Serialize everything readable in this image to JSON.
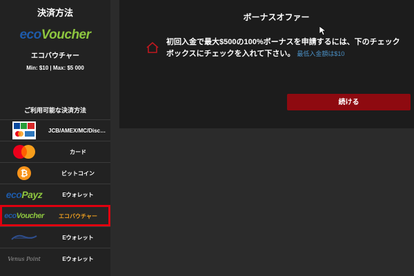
{
  "sidebar": {
    "title": "決済方法",
    "logo_text_a": "eco",
    "logo_text_b": "Voucher",
    "method_name": "エコバウチャー",
    "limits": "Min: $10 | Max: $5 000",
    "available_heading": "ご利用可能な決済方法",
    "methods": [
      {
        "label": "JCB/AMEX/MC/Disco…",
        "icon": "credit-cards-icon"
      },
      {
        "label": "カード",
        "icon": "mastercard-icon"
      },
      {
        "label": "ビットコイン",
        "icon": "bitcoin-icon"
      },
      {
        "label": "Eウォレット",
        "icon": "ecopayz-logo",
        "logo_a": "eco",
        "logo_b": "Payz"
      },
      {
        "label": "エコバウチャー",
        "icon": "ecovoucher-logo",
        "logo_a": "eco",
        "logo_b": "Voucher",
        "selected": true
      },
      {
        "label": "Eウォレット",
        "icon": "ewallet-logo-faded"
      },
      {
        "label": "Eウォレット",
        "icon": "venus-point-logo",
        "logo": "Venus Point"
      }
    ]
  },
  "main": {
    "title": "ボーナスオファー",
    "description": "初回入金で最大$500の100%ボーナスを申請するには、下のチェックボックスにチェックを入れて下さい。",
    "min_deposit": "最低入金額は$10",
    "continue_label": "続ける"
  },
  "colors": {
    "accent_red": "#8e0a10",
    "highlight_outline": "#e0000f",
    "eco_green": "#8dc63f",
    "eco_blue": "#1e5aa8",
    "link_blue": "#4a8fc4"
  }
}
